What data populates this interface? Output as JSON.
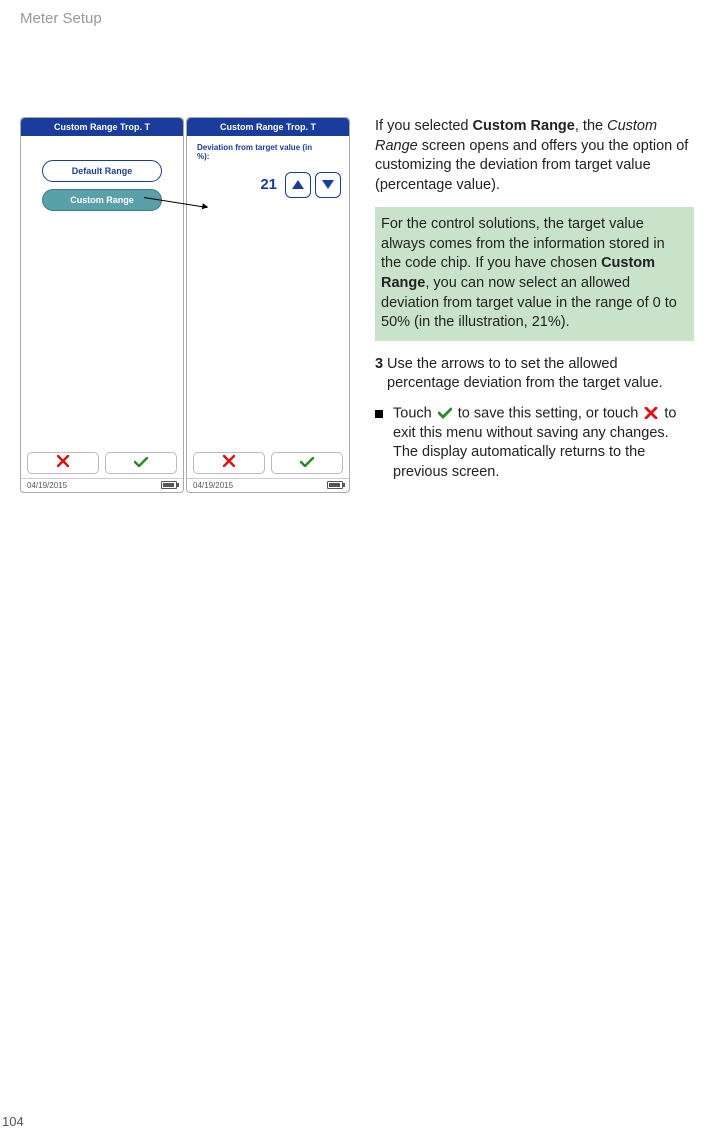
{
  "header": {
    "section": "Meter Setup"
  },
  "pageNumber": "104",
  "screens": {
    "left": {
      "title": "Custom Range Trop. T",
      "defaultRangeLabel": "Default Range",
      "customRangeLabel": "Custom Range",
      "footerDate": "04/19/2015"
    },
    "right": {
      "title": "Custom Range Trop. T",
      "deviationLabel": "Deviation from target value (in %):",
      "percentValue": "21",
      "footerDate": "04/19/2015"
    }
  },
  "text": {
    "intro1a": "If you selected ",
    "intro1b": "Custom Range",
    "intro1c": ", the ",
    "intro1d": "Custom Range",
    "intro1e": " screen opens and offers you the option of customizing the  deviation from target value (percentage value).",
    "note1a": "For the control solutions, the target value always comes from the information stored in the code chip.  If you have chosen ",
    "note1b": "Custom Range",
    "note1c": ", you can now select an allowed  deviation from target value in the range of 0 to 50% (in the illustration, 21%).",
    "stepNum": "3",
    "stepText": "Use the arrows to to set the allowed percentage deviation from the target value.",
    "bullet1a": "Touch ",
    "bullet1b": " to save this setting, or touch ",
    "bullet1c": " to exit this menu without saving any changes. The display automatically returns to the previous screen."
  }
}
